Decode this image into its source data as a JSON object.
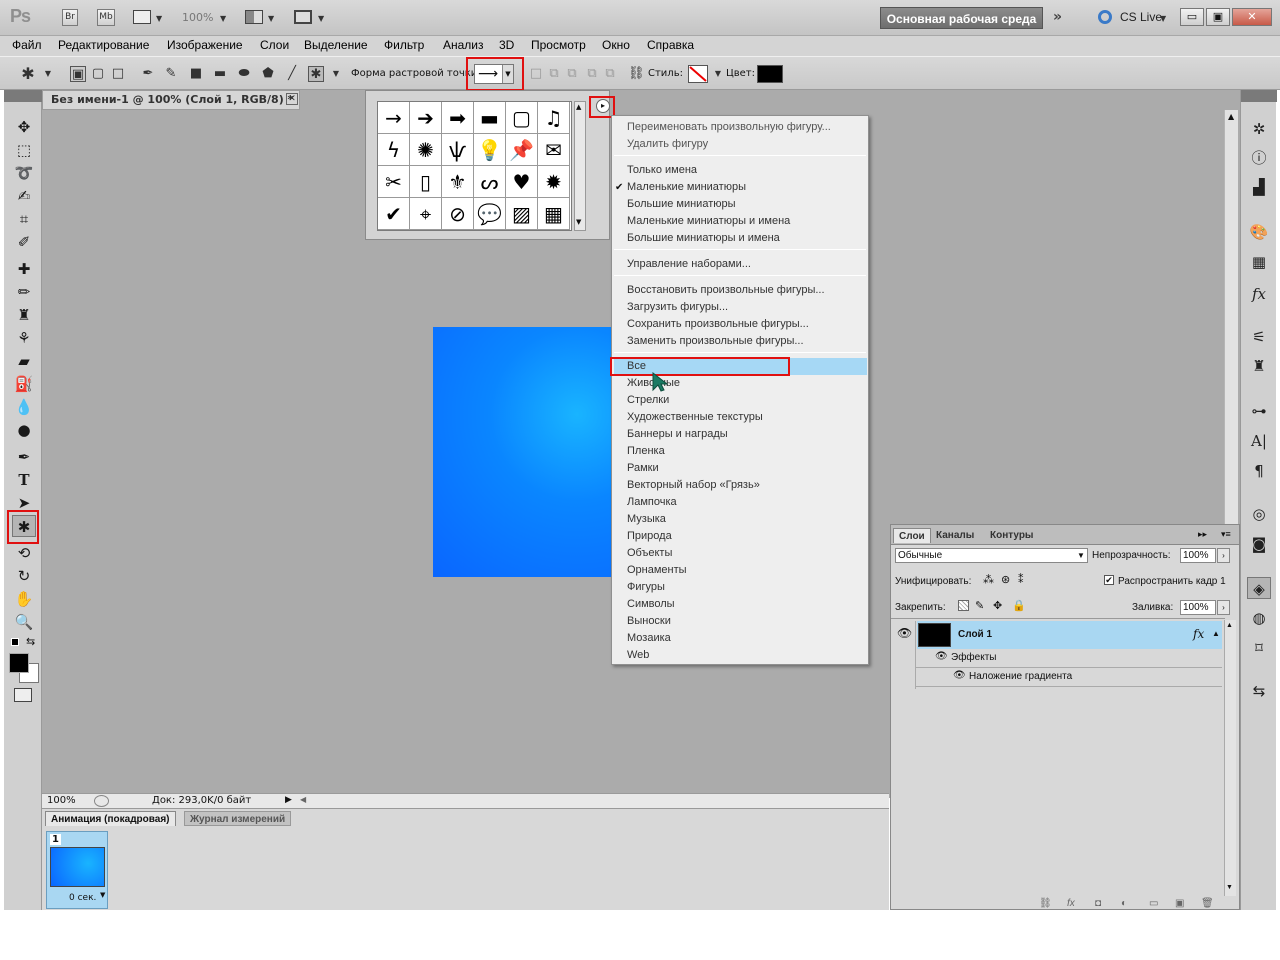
{
  "appbar": {
    "logo": "Ps",
    "br": "Br",
    "mb": "Mb",
    "zoom": "100%",
    "workspace": "Основная рабочая среда",
    "cslive": "CS Live",
    "win_min": "▭",
    "win_max": "▣",
    "win_close": "✕"
  },
  "menu": [
    "Файл",
    "Редактирование",
    "Изображение",
    "Слои",
    "Выделение",
    "Фильтр",
    "Анализ",
    "3D",
    "Просмотр",
    "Окно",
    "Справка"
  ],
  "options": {
    "shape_label": "Форма растровой точки:",
    "style_label": "Стиль:",
    "color_label": "Цвет:",
    "color": "#000000"
  },
  "document": {
    "tab_title": "Без имени-1 @ 100% (Слой 1, RGB/8) *",
    "zoom": "100%",
    "doc_info": "Док: 293,0K/0 байт"
  },
  "animation": {
    "tab_active": "Анимация (покадровая)",
    "tab_inactive": "Журнал измерений",
    "frame_number": "1",
    "frame_time": "0 сек."
  },
  "flyout": {
    "group1": [
      "Переименовать произвольную фигуру...",
      "Удалить фигуру"
    ],
    "group2": [
      "Только имена",
      "Маленькие миниатюры",
      "Большие миниатюры",
      "Маленькие миниатюры и имена",
      "Большие миниатюры и имена"
    ],
    "checked": "Маленькие миниатюры",
    "group3": [
      "Управление наборами..."
    ],
    "group4": [
      "Восстановить произвольные фигуры...",
      "Загрузить фигуры...",
      "Сохранить произвольные фигуры...",
      "Заменить произвольные фигуры..."
    ],
    "group5": [
      "Все",
      "Животные",
      "Стрелки",
      "Художественные текстуры",
      "Баннеры и награды",
      "Пленка",
      "Рамки",
      "Векторный набор «Грязь»",
      "Лампочка",
      "Музыка",
      "Природа",
      "Объекты",
      "Орнаменты",
      "Фигуры",
      "Символы",
      "Выноски",
      "Мозаика",
      "Web"
    ],
    "highlighted": "Все"
  },
  "layers": {
    "tabs": [
      "Слои",
      "Каналы",
      "Контуры"
    ],
    "blend_mode": "Обычные",
    "opacity_label": "Непрозрачность:",
    "opacity": "100%",
    "unify_label": "Унифицировать:",
    "propagate_label": "Распространить кадр 1",
    "lock_label": "Закрепить:",
    "fill_label": "Заливка:",
    "fill": "100%",
    "layer_name": "Слой 1",
    "fx": "fx",
    "effects_label": "Эффекты",
    "effect_item": "Наложение градиента"
  },
  "icons": {
    "left_tools": [
      "move-icon",
      "marquee-icon",
      "lasso-icon",
      "quick-selection-icon",
      "crop-icon",
      "eyedropper-icon",
      "healing-brush-icon",
      "brush-icon",
      "clone-stamp-icon",
      "history-brush-icon",
      "eraser-icon",
      "paint-bucket-icon",
      "blur-icon",
      "dodge-icon",
      "pen-icon",
      "type-icon",
      "path-selection-icon",
      "custom-shape-icon",
      "3d-rotate-icon",
      "3d-orbit-icon",
      "hand-icon",
      "zoom-icon"
    ]
  }
}
